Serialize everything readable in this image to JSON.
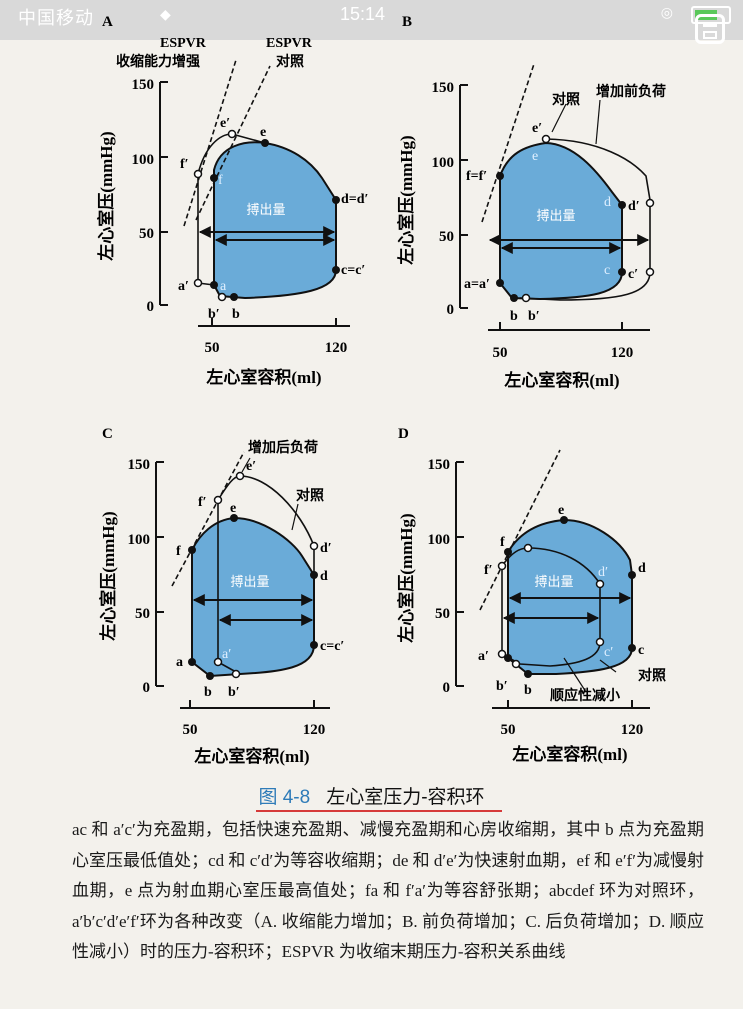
{
  "status_bar": {
    "carrier": "中国移动",
    "time": "15:14"
  },
  "figure": {
    "number": "图 4-8",
    "title": "左心室压力-容积环",
    "description": "ac 和 a′c′为充盈期，包括快速充盈期、减慢充盈期和心房收缩期，其中 b 点为充盈期心室压最低值处；cd 和 c′d′为等容收缩期；de 和 d′e′为快速射血期，ef 和 e′f′为减慢射血期，e 点为射血期心室压最高值处；fa 和 f′a′为等容舒张期；abcdef 环为对照环，a′b′c′d′e′f′环为各种改变（A. 收缩能力增加；B. 前负荷增加；C. 后负荷增加；D. 顺应性减小）时的压力-容积环；ESPVR 为收缩末期压力-容积关系曲线"
  },
  "panels": [
    {
      "id": "A",
      "ylabel": "左心室压(mmHg)",
      "xlabel": "左心室容积(ml)",
      "yticks": [
        "150",
        "100",
        "50",
        "0"
      ],
      "xticks": [
        "50",
        "120"
      ],
      "center_label": "搏出量",
      "annotations": [
        "ESPVR",
        "收缩能力增强",
        "ESPVR",
        "对照"
      ],
      "points": [
        "e′",
        "e",
        "f′",
        "f",
        "d=d′",
        "c=c′",
        "a′",
        "a",
        "b′",
        "b"
      ]
    },
    {
      "id": "B",
      "ylabel": "左心室压(mmHg)",
      "xlabel": "左心室容积(ml)",
      "yticks": [
        "150",
        "100",
        "50",
        "0"
      ],
      "xticks": [
        "50",
        "120"
      ],
      "center_label": "搏出量",
      "annotations": [
        "增加前负荷",
        "对照"
      ],
      "points": [
        "e′",
        "e",
        "f=f′",
        "d",
        "d′",
        "c",
        "c′",
        "a=a′",
        "b",
        "b′"
      ]
    },
    {
      "id": "C",
      "ylabel": "左心室压(mmHg)",
      "xlabel": "左心室容积(ml)",
      "yticks": [
        "150",
        "100",
        "50",
        "0"
      ],
      "xticks": [
        "50",
        "120"
      ],
      "center_label": "搏出量",
      "annotations": [
        "增加后负荷",
        "对照"
      ],
      "points": [
        "e′",
        "f′",
        "e",
        "f",
        "d′",
        "d",
        "c=c′",
        "a",
        "a′",
        "b",
        "b′"
      ]
    },
    {
      "id": "D",
      "ylabel": "左心室压(mmHg)",
      "xlabel": "左心室容积(ml)",
      "yticks": [
        "150",
        "100",
        "50",
        "0"
      ],
      "xticks": [
        "50",
        "120"
      ],
      "center_label": "搏出量",
      "annotations": [
        "对照",
        "顺应性减小"
      ],
      "points": [
        "e",
        "f",
        "f′",
        "d′",
        "d",
        "c′",
        "c",
        "a′",
        "b′",
        "b"
      ]
    }
  ],
  "colors": {
    "loop_fill": "#6aabd8",
    "caption_number": "#2e7bb8",
    "underline": "#d63a3a"
  }
}
